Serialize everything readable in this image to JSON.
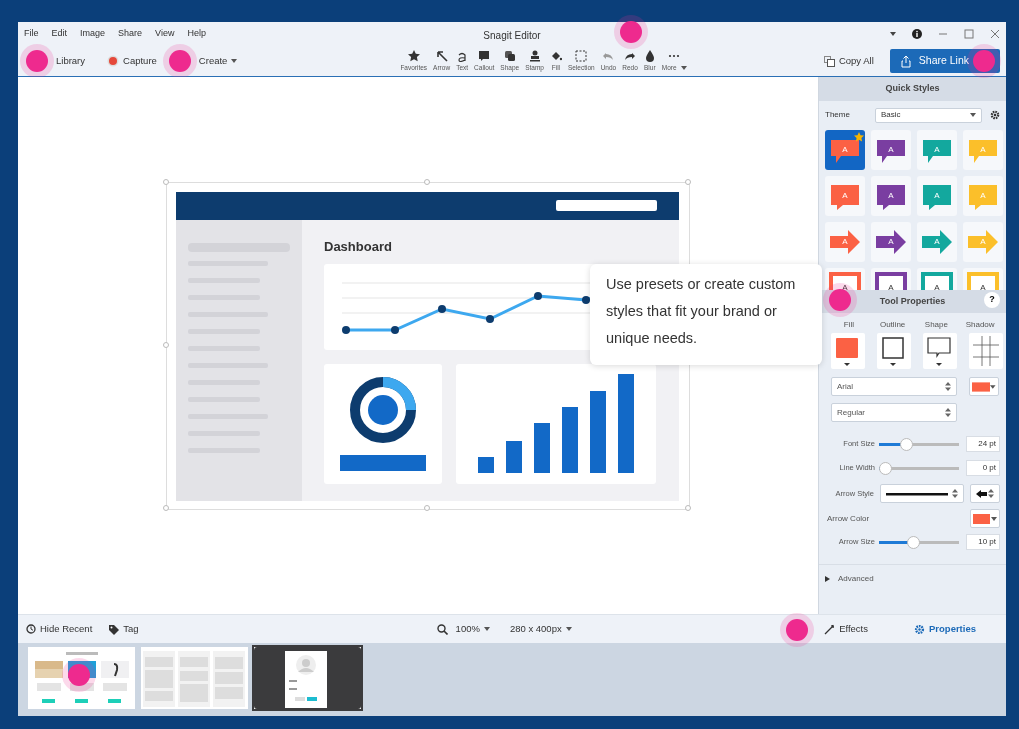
{
  "window": {
    "title": "Snagit Editor",
    "hotspot": true
  },
  "menu": [
    "File",
    "Edit",
    "Image",
    "Share",
    "View",
    "Help"
  ],
  "nav": [
    {
      "label": "Library",
      "kind": "library",
      "hotspot": true
    },
    {
      "label": "Capture",
      "kind": "capture",
      "hotspot": false
    },
    {
      "label": "Create",
      "kind": "create",
      "hotspot": true
    }
  ],
  "tools": [
    {
      "label": "Favorites",
      "kind": "star"
    },
    {
      "label": "Arrow",
      "kind": "arrow"
    },
    {
      "label": "Text",
      "kind": "text"
    },
    {
      "label": "Callout",
      "kind": "callout"
    },
    {
      "label": "Shape",
      "kind": "shape"
    },
    {
      "label": "Stamp",
      "kind": "stamp"
    },
    {
      "label": "Fill",
      "kind": "fill"
    },
    {
      "label": "Selection",
      "kind": "selection"
    },
    {
      "label": "Undo",
      "kind": "undo"
    },
    {
      "label": "Redo",
      "kind": "redo"
    },
    {
      "label": "Blur",
      "kind": "blur"
    },
    {
      "label": "More",
      "kind": "more"
    }
  ],
  "copy_all": "Copy All",
  "share_link": {
    "label": "Share Link",
    "hotspot": true
  },
  "canvas": {
    "heading": "Dashboard"
  },
  "tooltip": "Use presets or create custom styles that fit your brand or unique needs.",
  "quick_styles": {
    "title": "Quick Styles",
    "theme_label": "Theme",
    "theme": "Basic",
    "styles": [
      {
        "kind": "callout",
        "color": "#fb6144",
        "label": "A",
        "selected": true,
        "favorite": true
      },
      {
        "kind": "callout",
        "color": "#7a3ea1",
        "label": "A",
        "selected": false,
        "favorite": false
      },
      {
        "kind": "callout",
        "color": "#13a89e",
        "label": "A",
        "selected": false,
        "favorite": false
      },
      {
        "kind": "callout",
        "color": "#fbbf2a",
        "label": "A",
        "selected": false,
        "favorite": false
      },
      {
        "kind": "speech",
        "color": "#fb6144",
        "label": "A",
        "selected": false,
        "favorite": false
      },
      {
        "kind": "speech",
        "color": "#7a3ea1",
        "label": "A",
        "selected": false,
        "favorite": false
      },
      {
        "kind": "speech",
        "color": "#13a89e",
        "label": "A",
        "selected": false,
        "favorite": false
      },
      {
        "kind": "speech",
        "color": "#fbbf2a",
        "label": "A",
        "selected": false,
        "favorite": false
      },
      {
        "kind": "arrow",
        "color": "#fb6144",
        "label": "A",
        "selected": false,
        "favorite": false
      },
      {
        "kind": "arrow",
        "color": "#7a3ea1",
        "label": "A",
        "selected": false,
        "favorite": false
      },
      {
        "kind": "arrow",
        "color": "#13a89e",
        "label": "A",
        "selected": false,
        "favorite": false
      },
      {
        "kind": "arrow",
        "color": "#fbbf2a",
        "label": "A",
        "selected": false,
        "favorite": false
      },
      {
        "kind": "outline",
        "color": "#fb6144",
        "label": "A",
        "selected": false,
        "favorite": false
      },
      {
        "kind": "outline",
        "color": "#7a3ea1",
        "label": "A",
        "selected": false,
        "favorite": false
      },
      {
        "kind": "outline",
        "color": "#13a89e",
        "label": "A",
        "selected": false,
        "favorite": false
      },
      {
        "kind": "outline",
        "color": "#fbbf2a",
        "label": "A",
        "selected": false,
        "favorite": false
      }
    ]
  },
  "tool_properties": {
    "title": "Tool Properties",
    "help": "?",
    "hotspot": true,
    "style_buttons": [
      {
        "label": "Fill",
        "kind": "fill"
      },
      {
        "label": "Outline",
        "kind": "outline"
      },
      {
        "label": "Shape",
        "kind": "shape"
      },
      {
        "label": "Shadow",
        "kind": "shadow"
      }
    ],
    "font": "Arial",
    "font_style": "Regular",
    "font_size": {
      "label": "Font Size",
      "level": 0.32,
      "value": "24 pt"
    },
    "line_width": {
      "label": "Line Width",
      "level": 0,
      "value": "0 pt"
    },
    "arrow_style_label": "Arrow Style",
    "arrow_color_label": "Arrow Color",
    "arrow_size": {
      "label": "Arrow Size",
      "level": 0.42,
      "value": "10 pt"
    },
    "advanced": {
      "label": "Advanced",
      "expanded": false
    }
  },
  "bottom_bar": {
    "hide_recent": "Hide Recent",
    "tag": "Tag",
    "zoom": "100%",
    "size": "280 x 400px",
    "panels": [
      {
        "label": "Effects",
        "kind": "effects",
        "selected": false,
        "hotspot": true
      },
      {
        "label": "Properties",
        "kind": "properties",
        "selected": true,
        "hotspot": false
      }
    ]
  },
  "recent": [
    {
      "kind": "products",
      "selected": false,
      "hotspot": true
    },
    {
      "kind": "board",
      "selected": false,
      "hotspot": false
    },
    {
      "kind": "login",
      "selected": true,
      "hotspot": false
    }
  ]
}
